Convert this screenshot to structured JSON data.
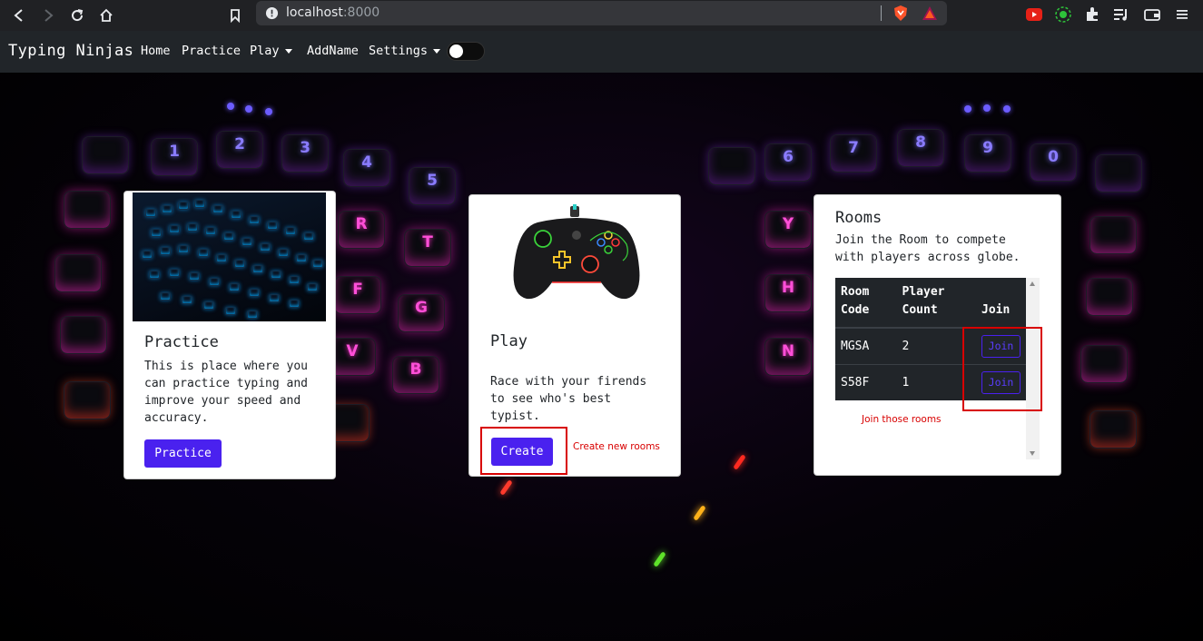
{
  "browser": {
    "url_host": "localhost",
    "url_port": ":8000",
    "icons": [
      "back-icon",
      "forward-icon",
      "reload-icon",
      "home-icon",
      "bookmark-icon",
      "info-icon",
      "brave-shield-icon",
      "brave-rewards-icon",
      "youtube-extension-icon",
      "green-extension-icon",
      "extensions-icon",
      "media-icon",
      "wallet-icon",
      "menu-icon"
    ]
  },
  "navbar": {
    "brand": "Typing Ninjas",
    "links": {
      "home": "Home",
      "practice": "Practice",
      "play": "Play",
      "addname": "AddName",
      "settings": "Settings"
    }
  },
  "background_keys": {
    "left_numbers": [
      "1",
      "2",
      "3",
      "4",
      "5"
    ],
    "left_letters": [
      "R",
      "T",
      "F",
      "G",
      "V",
      "B"
    ],
    "right_numbers": [
      "6",
      "7",
      "8",
      "9",
      "0"
    ],
    "right_letters": [
      "Y",
      "H",
      "N"
    ]
  },
  "practice_card": {
    "title": "Practice",
    "text": "This is place where you can practice typing and improve your speed and accuracy.",
    "button": "Practice"
  },
  "play_card": {
    "title": "Play",
    "text": "Race with your firends to see who's best typist.",
    "button": "Create",
    "annotation": "Create new rooms"
  },
  "rooms_card": {
    "title": "Rooms",
    "text": "Join the Room to compete with players across globe.",
    "headers": [
      "Room Code",
      "Player Count",
      "Join"
    ],
    "rows": [
      {
        "code": "MGSA",
        "count": "2",
        "join": "Join"
      },
      {
        "code": "S58F",
        "count": "1",
        "join": "Join"
      }
    ],
    "annotation": "Join those rooms"
  },
  "colors": {
    "primary": "#4a21ef",
    "annotation": "#d80000",
    "navbar": "#212529",
    "table": "#212529"
  }
}
